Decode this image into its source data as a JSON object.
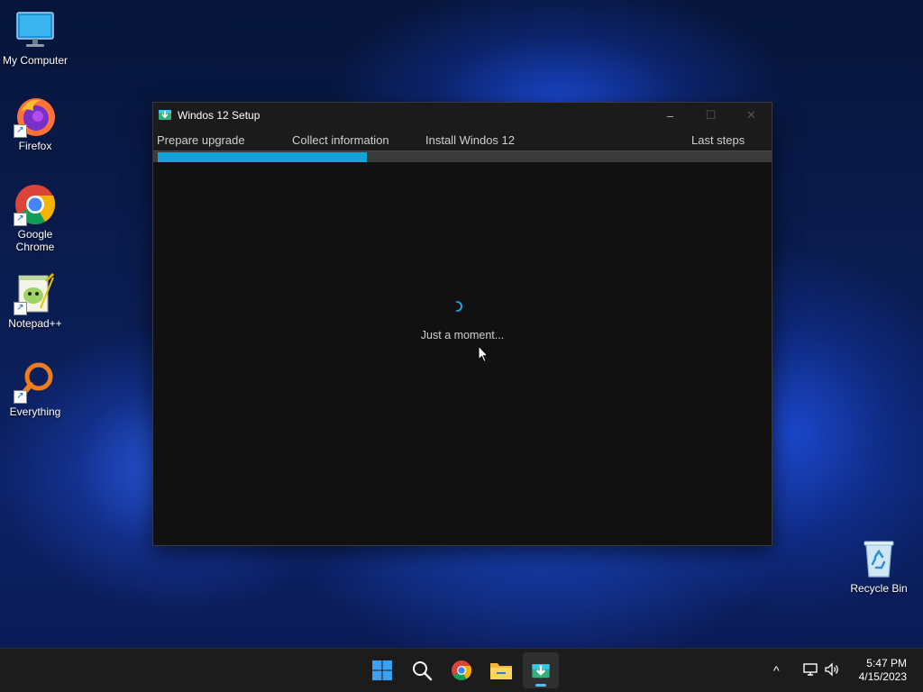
{
  "desktop": {
    "icons": [
      {
        "label": "My Computer"
      },
      {
        "label": "Firefox"
      },
      {
        "label": "Google Chrome"
      },
      {
        "label": "Notepad++"
      },
      {
        "label": "Everything"
      },
      {
        "label": "Recycle Bin"
      }
    ]
  },
  "window": {
    "title": "Windos 12 Setup",
    "controls": {
      "minimize": "–",
      "maximize": "☐",
      "close": "✕"
    },
    "steps": [
      "Prepare upgrade",
      "Collect information",
      "Install Windos 12",
      "Last steps"
    ],
    "progress_percent": 34,
    "status_text": "Just a moment...",
    "accent_color": "#12a4d6"
  },
  "taskbar": {
    "items": [
      "start-icon",
      "search-icon",
      "chrome-icon",
      "file-explorer-icon",
      "setup-icon"
    ],
    "tray": {
      "chevron": "^",
      "icons": [
        "network-icon",
        "volume-icon"
      ]
    },
    "clock": {
      "time": "5:47 PM",
      "date": "4/15/2023"
    }
  }
}
